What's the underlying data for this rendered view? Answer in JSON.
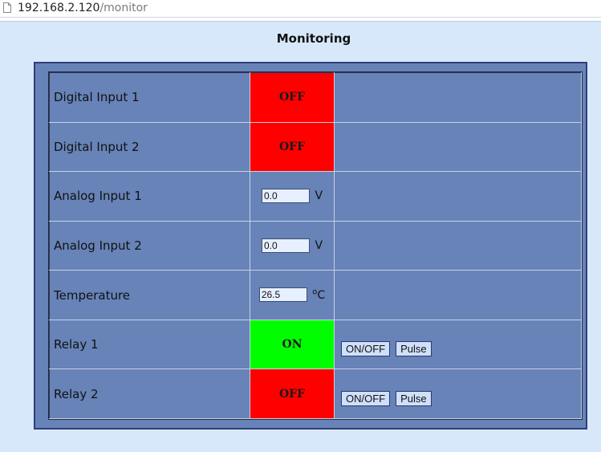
{
  "browser": {
    "url_host": "192.168.2.120",
    "url_path": "/monitor"
  },
  "page": {
    "title": "Monitoring"
  },
  "rows": [
    {
      "label": "Digital Input 1",
      "state": "OFF"
    },
    {
      "label": "Digital Input 2",
      "state": "OFF"
    },
    {
      "label": "Analog Input 1",
      "value": "0.0",
      "unit": "V"
    },
    {
      "label": "Analog Input 2",
      "value": "0.0",
      "unit": "V"
    },
    {
      "label": "Temperature",
      "value": "26.5",
      "unit_prefix": "o",
      "unit": "C"
    },
    {
      "label": "Relay 1",
      "state": "ON",
      "toggle_label": "ON/OFF",
      "pulse_label": "Pulse"
    },
    {
      "label": "Relay 2",
      "state": "OFF",
      "toggle_label": "ON/OFF",
      "pulse_label": "Pulse"
    }
  ],
  "colors": {
    "off": "#fe0000",
    "on": "#00fe00",
    "panel": "#6783b8",
    "page_background": "#d8e8fb"
  }
}
